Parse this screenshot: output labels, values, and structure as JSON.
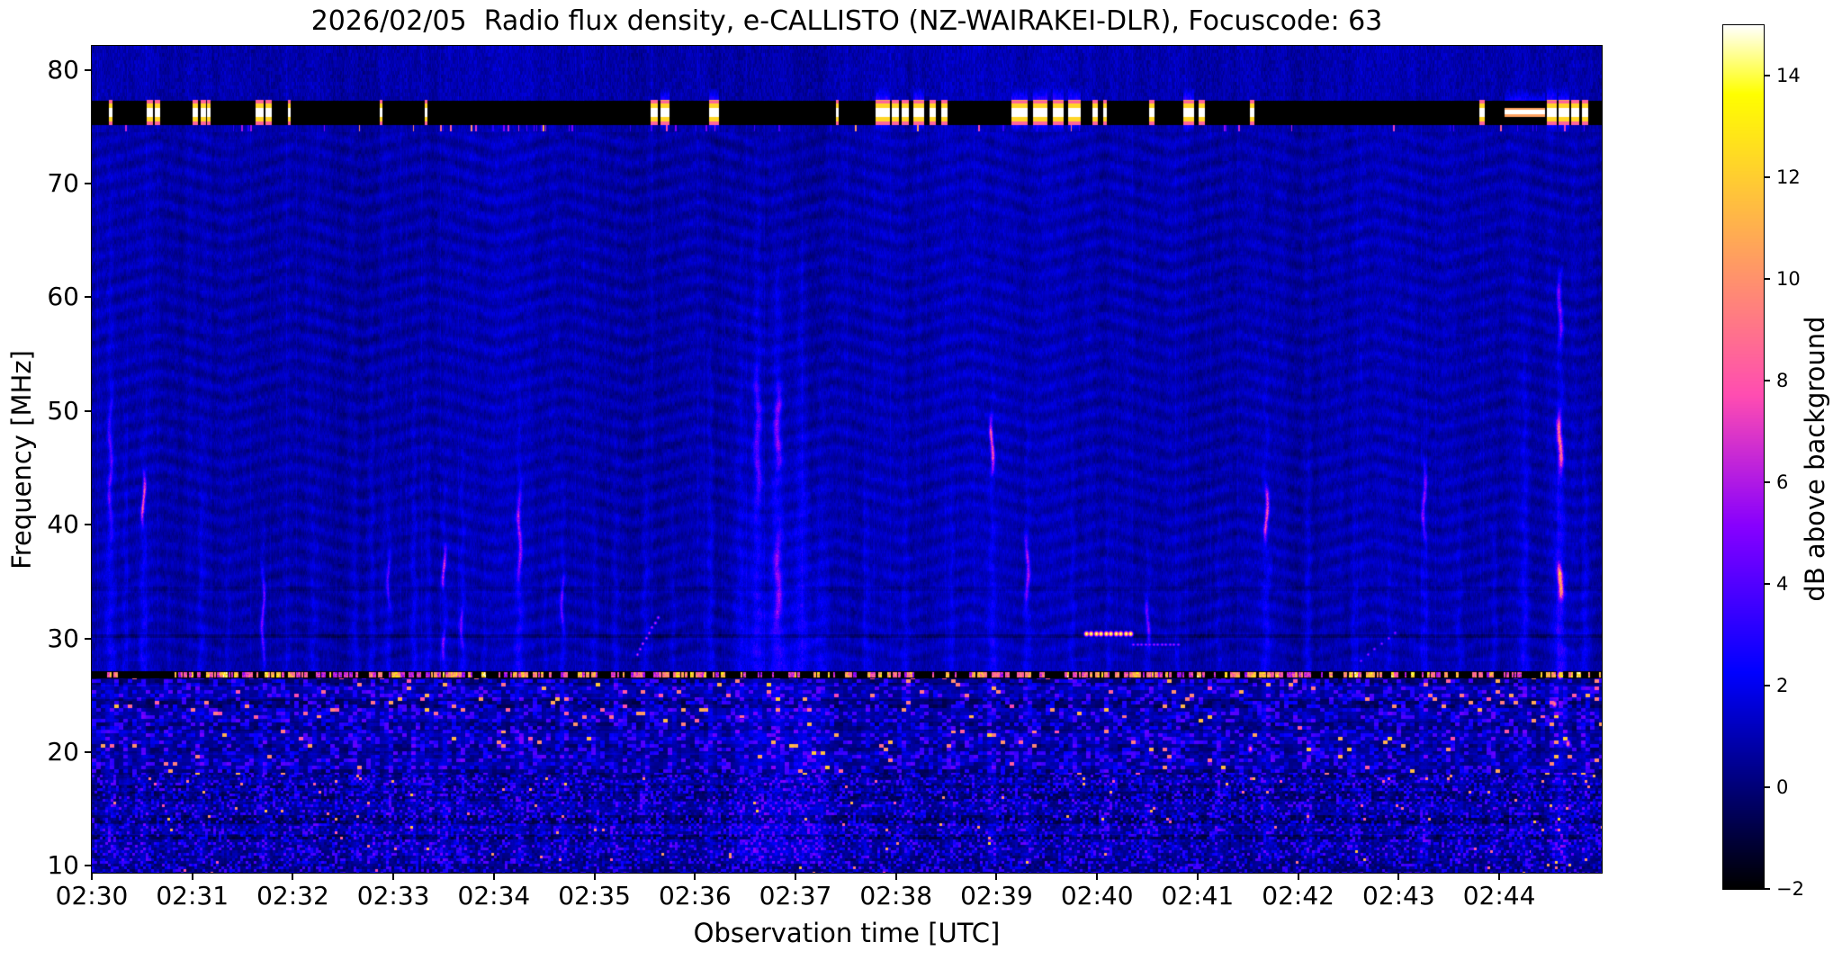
{
  "chart_data": {
    "type": "heatmap",
    "subtype": "radio_spectrogram",
    "title": "2026/02/05  Radio flux density, e-CALLISTO (NZ-WAIRAKEI-DLR), Focuscode: 63",
    "xlabel": "Observation time [UTC]",
    "ylabel": "Frequency [MHz]",
    "x_tick_labels": [
      "02:30",
      "02:31",
      "02:32",
      "02:33",
      "02:34",
      "02:35",
      "02:36",
      "02:37",
      "02:38",
      "02:39",
      "02:40",
      "02:41",
      "02:42",
      "02:43",
      "02:44"
    ],
    "x_tick_minutes": [
      0,
      1,
      2,
      3,
      4,
      5,
      6,
      7,
      8,
      9,
      10,
      11,
      12,
      13,
      14
    ],
    "time_span_minutes": 15.02,
    "y_ticks_mhz": [
      80,
      70,
      60,
      50,
      40,
      30,
      20,
      10
    ],
    "freq_range_mhz": [
      9.4,
      82.1
    ],
    "grid": false,
    "background_level_db": [
      0,
      2
    ],
    "colorbar": {
      "label": "dB above background",
      "ticks": [
        14,
        12,
        10,
        8,
        6,
        4,
        2,
        0,
        -2
      ],
      "vmin": -2,
      "vmax": 15,
      "colormap": "gnuplot2",
      "position": "right"
    },
    "features": {
      "rfi_blanked_band_mhz": [
        75.15,
        77.3
      ],
      "band_center_mhz": 76.25,
      "band_bursts_minutes": [
        [
          0.17,
          0.2
        ],
        [
          0.55,
          0.6
        ],
        [
          0.63,
          0.67
        ],
        [
          1.0,
          1.05
        ],
        [
          1.08,
          1.13
        ],
        [
          1.15,
          1.17
        ],
        [
          1.63,
          1.7
        ],
        [
          1.73,
          1.78
        ],
        [
          1.95,
          1.97
        ],
        [
          2.86,
          2.88
        ],
        [
          3.31,
          3.33
        ],
        [
          5.56,
          5.62
        ],
        [
          5.66,
          5.74
        ],
        [
          6.14,
          6.23
        ],
        [
          7.4,
          7.42
        ],
        [
          7.8,
          7.93
        ],
        [
          7.96,
          8.02
        ],
        [
          8.06,
          8.12
        ],
        [
          8.17,
          8.27
        ],
        [
          8.33,
          8.39
        ],
        [
          8.45,
          8.5
        ],
        [
          9.15,
          9.3
        ],
        [
          9.36,
          9.5
        ],
        [
          9.56,
          9.66
        ],
        [
          9.71,
          9.83
        ],
        [
          9.95,
          10.0
        ],
        [
          10.06,
          10.09
        ],
        [
          10.52,
          10.56
        ],
        [
          10.86,
          10.96
        ],
        [
          11.01,
          11.06
        ],
        [
          11.52,
          11.56
        ],
        [
          13.8,
          13.85
        ],
        [
          14.47,
          14.56
        ],
        [
          14.59,
          14.69
        ],
        [
          14.72,
          14.79
        ],
        [
          14.82,
          14.88
        ]
      ],
      "band_white_line_minutes": [
        14.05,
        14.45
      ],
      "rfi_line_27mhz": {
        "freq_mhz": [
          26.5,
          27.1
        ],
        "dash_density_segments": [
          [
            0,
            0.85,
            0.25
          ],
          [
            0.85,
            6.3,
            0.6
          ],
          [
            6.3,
            8.4,
            0.3
          ],
          [
            8.4,
            13.6,
            0.55
          ],
          [
            13.6,
            15.02,
            0.35
          ]
        ]
      },
      "dark_lines_mhz": [
        [
          30.05,
          30.35,
          0.9
        ],
        [
          34.2,
          34.5,
          0.4
        ]
      ],
      "streak_format": "[t_min, f_top_mhz, amp_db, sigma_px, cores[[f1_mhz,f2_mhz,amp_db]]]",
      "streaks": [
        [
          0.18,
          76,
          2.0,
          3,
          [
            [
              38,
              52,
              2.2
            ]
          ]
        ],
        [
          0.33,
          55,
          1.4,
          2
        ],
        [
          0.51,
          50,
          2.2,
          2.5,
          [
            [
              39.5,
              45,
              6.0
            ]
          ]
        ],
        [
          0.75,
          40,
          1.2,
          2
        ],
        [
          1.08,
          52,
          1.7,
          2.5
        ],
        [
          1.35,
          38,
          1.2,
          2
        ],
        [
          1.7,
          42,
          2.2,
          2.5,
          [
            [
              27,
              37,
              3.0
            ]
          ]
        ],
        [
          1.95,
          36,
          1.4,
          2
        ],
        [
          2.2,
          44,
          1.6,
          2.5
        ],
        [
          2.62,
          50,
          1.7,
          2.5
        ],
        [
          2.78,
          62,
          1.7,
          2.5
        ],
        [
          2.95,
          45,
          2.0,
          2.5,
          [
            [
              32,
              38,
              2.5
            ]
          ]
        ],
        [
          3.2,
          56,
          2.0,
          2.5
        ],
        [
          3.35,
          50,
          1.8,
          2.5
        ],
        [
          3.5,
          46,
          2.4,
          2.5,
          [
            [
              34,
              38.5,
              4.5
            ],
            [
              28,
              31,
              3.0
            ]
          ]
        ],
        [
          3.68,
          50,
          2.0,
          2.5,
          [
            [
              29,
              33,
              2.5
            ]
          ]
        ],
        [
          3.9,
          40,
          1.4,
          2
        ],
        [
          4.25,
          55,
          2.4,
          3,
          [
            [
              34,
              44,
              3.5
            ]
          ]
        ],
        [
          4.5,
          42,
          1.6,
          2
        ],
        [
          4.68,
          48,
          2.0,
          2.5,
          [
            [
              30,
              36,
              2.5
            ]
          ]
        ],
        [
          5.0,
          42,
          1.5,
          2.5
        ],
        [
          5.2,
          50,
          1.7,
          2.5
        ],
        [
          5.5,
          55,
          1.8,
          2.5
        ],
        [
          5.78,
          44,
          1.7,
          2.5
        ],
        [
          6.15,
          60,
          1.9,
          3
        ],
        [
          6.45,
          72,
          2.0,
          4
        ],
        [
          6.62,
          75,
          2.4,
          5,
          [
            [
              40,
              55,
              2.2
            ]
          ]
        ],
        [
          6.82,
          65,
          2.8,
          5,
          [
            [
              44,
              53,
              3.0
            ],
            [
              30,
              40,
              2.5
            ]
          ]
        ],
        [
          7.05,
          68,
          2.6,
          6
        ],
        [
          7.25,
          56,
          2.2,
          5
        ],
        [
          7.7,
          48,
          1.7,
          3
        ],
        [
          8.1,
          52,
          1.7,
          3
        ],
        [
          8.55,
          45,
          1.5,
          2.5
        ],
        [
          8.95,
          60,
          2.2,
          3,
          [
            [
              44,
              50,
              6.0
            ]
          ]
        ],
        [
          9.3,
          55,
          2.0,
          3,
          [
            [
              32,
              40,
              3.5
            ]
          ]
        ],
        [
          9.75,
          50,
          1.7,
          2.5
        ],
        [
          10.1,
          45,
          1.7,
          2.5
        ],
        [
          10.5,
          40,
          2.0,
          3,
          [
            [
              29,
              34,
              3.0
            ]
          ]
        ],
        [
          10.8,
          38,
          1.5,
          2
        ],
        [
          11.2,
          45,
          1.7,
          2.5
        ],
        [
          11.68,
          65,
          2.2,
          3,
          [
            [
              38,
              44,
              5.5
            ]
          ]
        ],
        [
          12.1,
          48,
          1.7,
          2.5
        ],
        [
          12.55,
          44,
          1.7,
          2.5
        ],
        [
          12.9,
          40,
          1.5,
          2
        ],
        [
          13.25,
          52,
          2.0,
          3,
          [
            [
              38,
              46,
              3.5
            ]
          ]
        ],
        [
          13.6,
          48,
          1.7,
          2.5
        ],
        [
          13.95,
          44,
          1.7,
          2.5
        ],
        [
          14.25,
          58,
          1.9,
          3
        ],
        [
          14.6,
          64,
          3.2,
          4,
          [
            [
              44,
              50.5,
              6.5
            ],
            [
              33,
              37,
              8.0
            ],
            [
              55,
              63,
              3.0
            ]
          ]
        ],
        [
          14.85,
          52,
          2.0,
          3
        ]
      ],
      "dash_blobs_30mhz": {
        "t": [
          9.89,
          10.33
        ],
        "f": [
          30.15,
          30.78
        ],
        "level_db": 14.5,
        "count": 10
      },
      "dash_line_29mhz": {
        "t": [
          10.36,
          10.8
        ],
        "f": [
          29.32,
          29.6
        ],
        "level_db": 6.3,
        "count": 12
      },
      "diagonal_streaks": [
        {
          "t": [
            5.42,
            5.63
          ],
          "f": [
            28.6,
            31.9
          ],
          "level_db": 7.6,
          "steps": 15
        },
        {
          "t": [
            12.62,
            13.0
          ],
          "f": [
            28.1,
            30.8
          ],
          "level_db": 6.2,
          "steps": 12
        }
      ],
      "speckle_band": {
        "f_max_mhz": 26.5,
        "dark_rows_mhz": [
          [
            24.7,
            23.9
          ],
          [
            22.7,
            21.9
          ],
          [
            18.5,
            17.7
          ],
          [
            16.5,
            15.7
          ],
          [
            14.5,
            13.7
          ],
          [
            12.7,
            12.3
          ]
        ],
        "orange_speckle_rows_mhz": [
          [
            25.9,
            23.0
          ],
          [
            21.9,
            20.4
          ]
        ]
      },
      "hot_blobs": [
        [
          14.55,
          24.3,
          10.0
        ],
        [
          14.68,
          20.8,
          9.5
        ],
        [
          11.52,
          20.3,
          9.0
        ],
        [
          14.6,
          26.8,
          13.0
        ]
      ]
    }
  }
}
